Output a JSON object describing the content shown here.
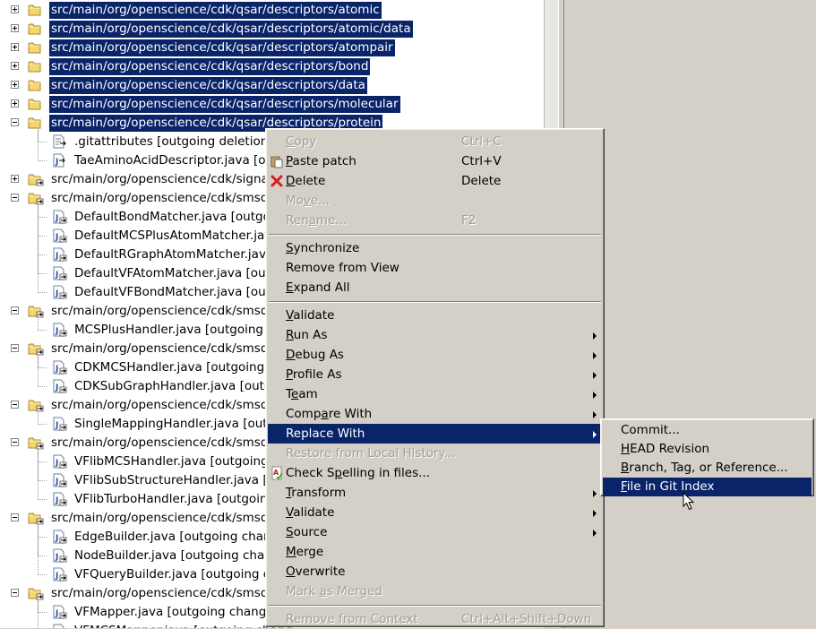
{
  "tree": {
    "rows": [
      {
        "label": "src/main/org/openscience/cdk/qsar/descriptors/atomic",
        "selected": true,
        "expander": "plus",
        "icon": "folder-icon"
      },
      {
        "label": "src/main/org/openscience/cdk/qsar/descriptors/atomic/data",
        "selected": true,
        "expander": "plus",
        "icon": "folder-icon"
      },
      {
        "label": "src/main/org/openscience/cdk/qsar/descriptors/atompair",
        "selected": true,
        "expander": "plus",
        "icon": "folder-icon"
      },
      {
        "label": "src/main/org/openscience/cdk/qsar/descriptors/bond",
        "selected": true,
        "expander": "plus",
        "icon": "folder-icon"
      },
      {
        "label": "src/main/org/openscience/cdk/qsar/descriptors/data",
        "selected": true,
        "expander": "plus",
        "icon": "folder-icon"
      },
      {
        "label": "src/main/org/openscience/cdk/qsar/descriptors/molecular",
        "selected": true,
        "expander": "plus",
        "icon": "folder-icon"
      },
      {
        "label": "src/main/org/openscience/cdk/qsar/descriptors/protein",
        "selected": true,
        "expander": "minus",
        "icon": "folder-icon"
      },
      {
        "label": ".gitattributes [outgoing deletion]",
        "selected": false,
        "expander": "none",
        "icon": "file-deletion-icon"
      },
      {
        "label": "TaeAminoAcidDescriptor.java [ou",
        "selected": false,
        "expander": "none",
        "icon": "java-file-icon"
      },
      {
        "label": "src/main/org/openscience/cdk/signat",
        "selected": false,
        "expander": "plus",
        "icon": "folder-change-icon"
      },
      {
        "label": "src/main/org/openscience/cdk/smsd",
        "selected": false,
        "expander": "minus",
        "icon": "folder-change-icon"
      },
      {
        "label": "DefaultBondMatcher.java [outgo",
        "selected": false,
        "expander": "none",
        "icon": "java-file-change-icon"
      },
      {
        "label": "DefaultMCSPlusAtomMatcher.java",
        "selected": false,
        "expander": "none",
        "icon": "java-file-change-icon"
      },
      {
        "label": "DefaultRGraphAtomMatcher.java",
        "selected": false,
        "expander": "none",
        "icon": "java-file-change-icon"
      },
      {
        "label": "DefaultVFAtomMatcher.java [ou",
        "selected": false,
        "expander": "none",
        "icon": "java-file-change-icon"
      },
      {
        "label": "DefaultVFBondMatcher.java [out",
        "selected": false,
        "expander": "none",
        "icon": "java-file-change-icon"
      },
      {
        "label": "src/main/org/openscience/cdk/smsd",
        "selected": false,
        "expander": "minus",
        "icon": "folder-change-icon"
      },
      {
        "label": "MCSPlusHandler.java [outgoing c",
        "selected": false,
        "expander": "none",
        "icon": "java-file-change-icon"
      },
      {
        "label": "src/main/org/openscience/cdk/smsd",
        "selected": false,
        "expander": "minus",
        "icon": "folder-change-icon"
      },
      {
        "label": "CDKMCSHandler.java [outgoing",
        "selected": false,
        "expander": "none",
        "icon": "java-file-change-icon"
      },
      {
        "label": "CDKSubGraphHandler.java [outg",
        "selected": false,
        "expander": "none",
        "icon": "java-file-change-icon"
      },
      {
        "label": "src/main/org/openscience/cdk/smsd",
        "selected": false,
        "expander": "minus",
        "icon": "folder-change-icon"
      },
      {
        "label": "SingleMappingHandler.java [outg",
        "selected": false,
        "expander": "none",
        "icon": "java-file-change-icon"
      },
      {
        "label": "src/main/org/openscience/cdk/smsd",
        "selected": false,
        "expander": "minus",
        "icon": "folder-change-icon"
      },
      {
        "label": "VFlibMCSHandler.java [outgoing",
        "selected": false,
        "expander": "none",
        "icon": "java-file-change-icon"
      },
      {
        "label": "VFlibSubStructureHandler.java [o",
        "selected": false,
        "expander": "none",
        "icon": "java-file-change-icon"
      },
      {
        "label": "VFlibTurboHandler.java [outgoing",
        "selected": false,
        "expander": "none",
        "icon": "java-file-change-icon"
      },
      {
        "label": "src/main/org/openscience/cdk/smsd",
        "selected": false,
        "expander": "minus",
        "icon": "folder-change-icon"
      },
      {
        "label": "EdgeBuilder.java [outgoing chan",
        "selected": false,
        "expander": "none",
        "icon": "java-file-change-icon"
      },
      {
        "label": "NodeBuilder.java [outgoing chan",
        "selected": false,
        "expander": "none",
        "icon": "java-file-change-icon"
      },
      {
        "label": "VFQueryBuilder.java [outgoing c",
        "selected": false,
        "expander": "none",
        "icon": "java-file-change-icon"
      },
      {
        "label": "src/main/org/openscience/cdk/smsd",
        "selected": false,
        "expander": "minus",
        "icon": "folder-change-icon"
      },
      {
        "label": "VFMapper.java [outgoing change",
        "selected": false,
        "expander": "none",
        "icon": "java-file-change-icon"
      },
      {
        "label": "VFMCSMapper.java [outgoing chang",
        "selected": false,
        "expander": "none",
        "icon": "java-file-change-icon"
      }
    ]
  },
  "context_menu": {
    "items": [
      {
        "type": "item",
        "label": "Copy",
        "mnemonic": 0,
        "shortcut": "Ctrl+C",
        "disabled": true,
        "icon": "copy-icon"
      },
      {
        "type": "item",
        "label": "Paste patch",
        "mnemonic": 0,
        "shortcut": "Ctrl+V",
        "disabled": false,
        "icon": "paste-icon"
      },
      {
        "type": "item",
        "label": "Delete",
        "mnemonic": 0,
        "shortcut": "Delete",
        "disabled": false,
        "icon": "delete-icon"
      },
      {
        "type": "item",
        "label": "Move...",
        "mnemonic": 2,
        "shortcut": "",
        "disabled": true,
        "icon": ""
      },
      {
        "type": "item",
        "label": "Rename...",
        "mnemonic": 3,
        "shortcut": "F2",
        "disabled": true,
        "icon": ""
      },
      {
        "type": "sep"
      },
      {
        "type": "item",
        "label": "Synchronize",
        "mnemonic": 0,
        "shortcut": "",
        "disabled": false,
        "icon": ""
      },
      {
        "type": "item",
        "label": "Remove from View",
        "mnemonic": -1,
        "shortcut": "",
        "disabled": false,
        "icon": ""
      },
      {
        "type": "item",
        "label": "Expand All",
        "mnemonic": 0,
        "shortcut": "",
        "disabled": false,
        "icon": ""
      },
      {
        "type": "sep"
      },
      {
        "type": "item",
        "label": "Validate",
        "mnemonic": 0,
        "shortcut": "",
        "disabled": false,
        "icon": ""
      },
      {
        "type": "item",
        "label": "Run As",
        "mnemonic": 0,
        "shortcut": "",
        "disabled": false,
        "icon": "",
        "submenu": true
      },
      {
        "type": "item",
        "label": "Debug As",
        "mnemonic": 0,
        "shortcut": "",
        "disabled": false,
        "icon": "",
        "submenu": true
      },
      {
        "type": "item",
        "label": "Profile As",
        "mnemonic": 0,
        "shortcut": "",
        "disabled": false,
        "icon": "",
        "submenu": true
      },
      {
        "type": "item",
        "label": "Team",
        "mnemonic": 1,
        "shortcut": "",
        "disabled": false,
        "icon": "",
        "submenu": true
      },
      {
        "type": "item",
        "label": "Compare With",
        "mnemonic": 4,
        "shortcut": "",
        "disabled": false,
        "icon": "",
        "submenu": true
      },
      {
        "type": "item",
        "label": "Replace With",
        "mnemonic": -1,
        "shortcut": "",
        "disabled": false,
        "icon": "",
        "submenu": true,
        "highlighted": true
      },
      {
        "type": "item",
        "label": "Restore from Local History...",
        "mnemonic": -1,
        "shortcut": "",
        "disabled": true,
        "icon": ""
      },
      {
        "type": "item",
        "label": "Check Spelling in files...",
        "mnemonic": 7,
        "shortcut": "",
        "disabled": false,
        "icon": "spell-check-icon"
      },
      {
        "type": "item",
        "label": "Transform",
        "mnemonic": 0,
        "shortcut": "",
        "disabled": false,
        "icon": "",
        "submenu": true
      },
      {
        "type": "item",
        "label": "Validate",
        "mnemonic": 0,
        "shortcut": "",
        "disabled": false,
        "icon": "",
        "submenu": true
      },
      {
        "type": "item",
        "label": "Source",
        "mnemonic": 0,
        "shortcut": "",
        "disabled": false,
        "icon": "",
        "submenu": true
      },
      {
        "type": "item",
        "label": "Merge",
        "mnemonic": 0,
        "shortcut": "",
        "disabled": false,
        "icon": ""
      },
      {
        "type": "item",
        "label": "Overwrite",
        "mnemonic": 0,
        "shortcut": "",
        "disabled": false,
        "icon": ""
      },
      {
        "type": "item",
        "label": "Mark as Merged",
        "mnemonic": 5,
        "shortcut": "",
        "disabled": true,
        "icon": ""
      },
      {
        "type": "sep"
      },
      {
        "type": "item",
        "label": "Remove from Context",
        "mnemonic": -1,
        "shortcut": "Ctrl+Alt+Shift+Down",
        "disabled": true,
        "icon": ""
      }
    ]
  },
  "submenu": {
    "items": [
      {
        "label": "Commit...",
        "mnemonic": -1,
        "highlighted": false
      },
      {
        "label": "HEAD Revision",
        "mnemonic": 0,
        "highlighted": false
      },
      {
        "label": "Branch, Tag, or Reference...",
        "mnemonic": 0,
        "highlighted": false
      },
      {
        "label": "File in Git Index",
        "mnemonic": 0,
        "highlighted": true
      }
    ]
  },
  "colors": {
    "selection": "#0a246a",
    "menu_bg": "#d4d0c8",
    "disabled_text": "#a19e97"
  }
}
